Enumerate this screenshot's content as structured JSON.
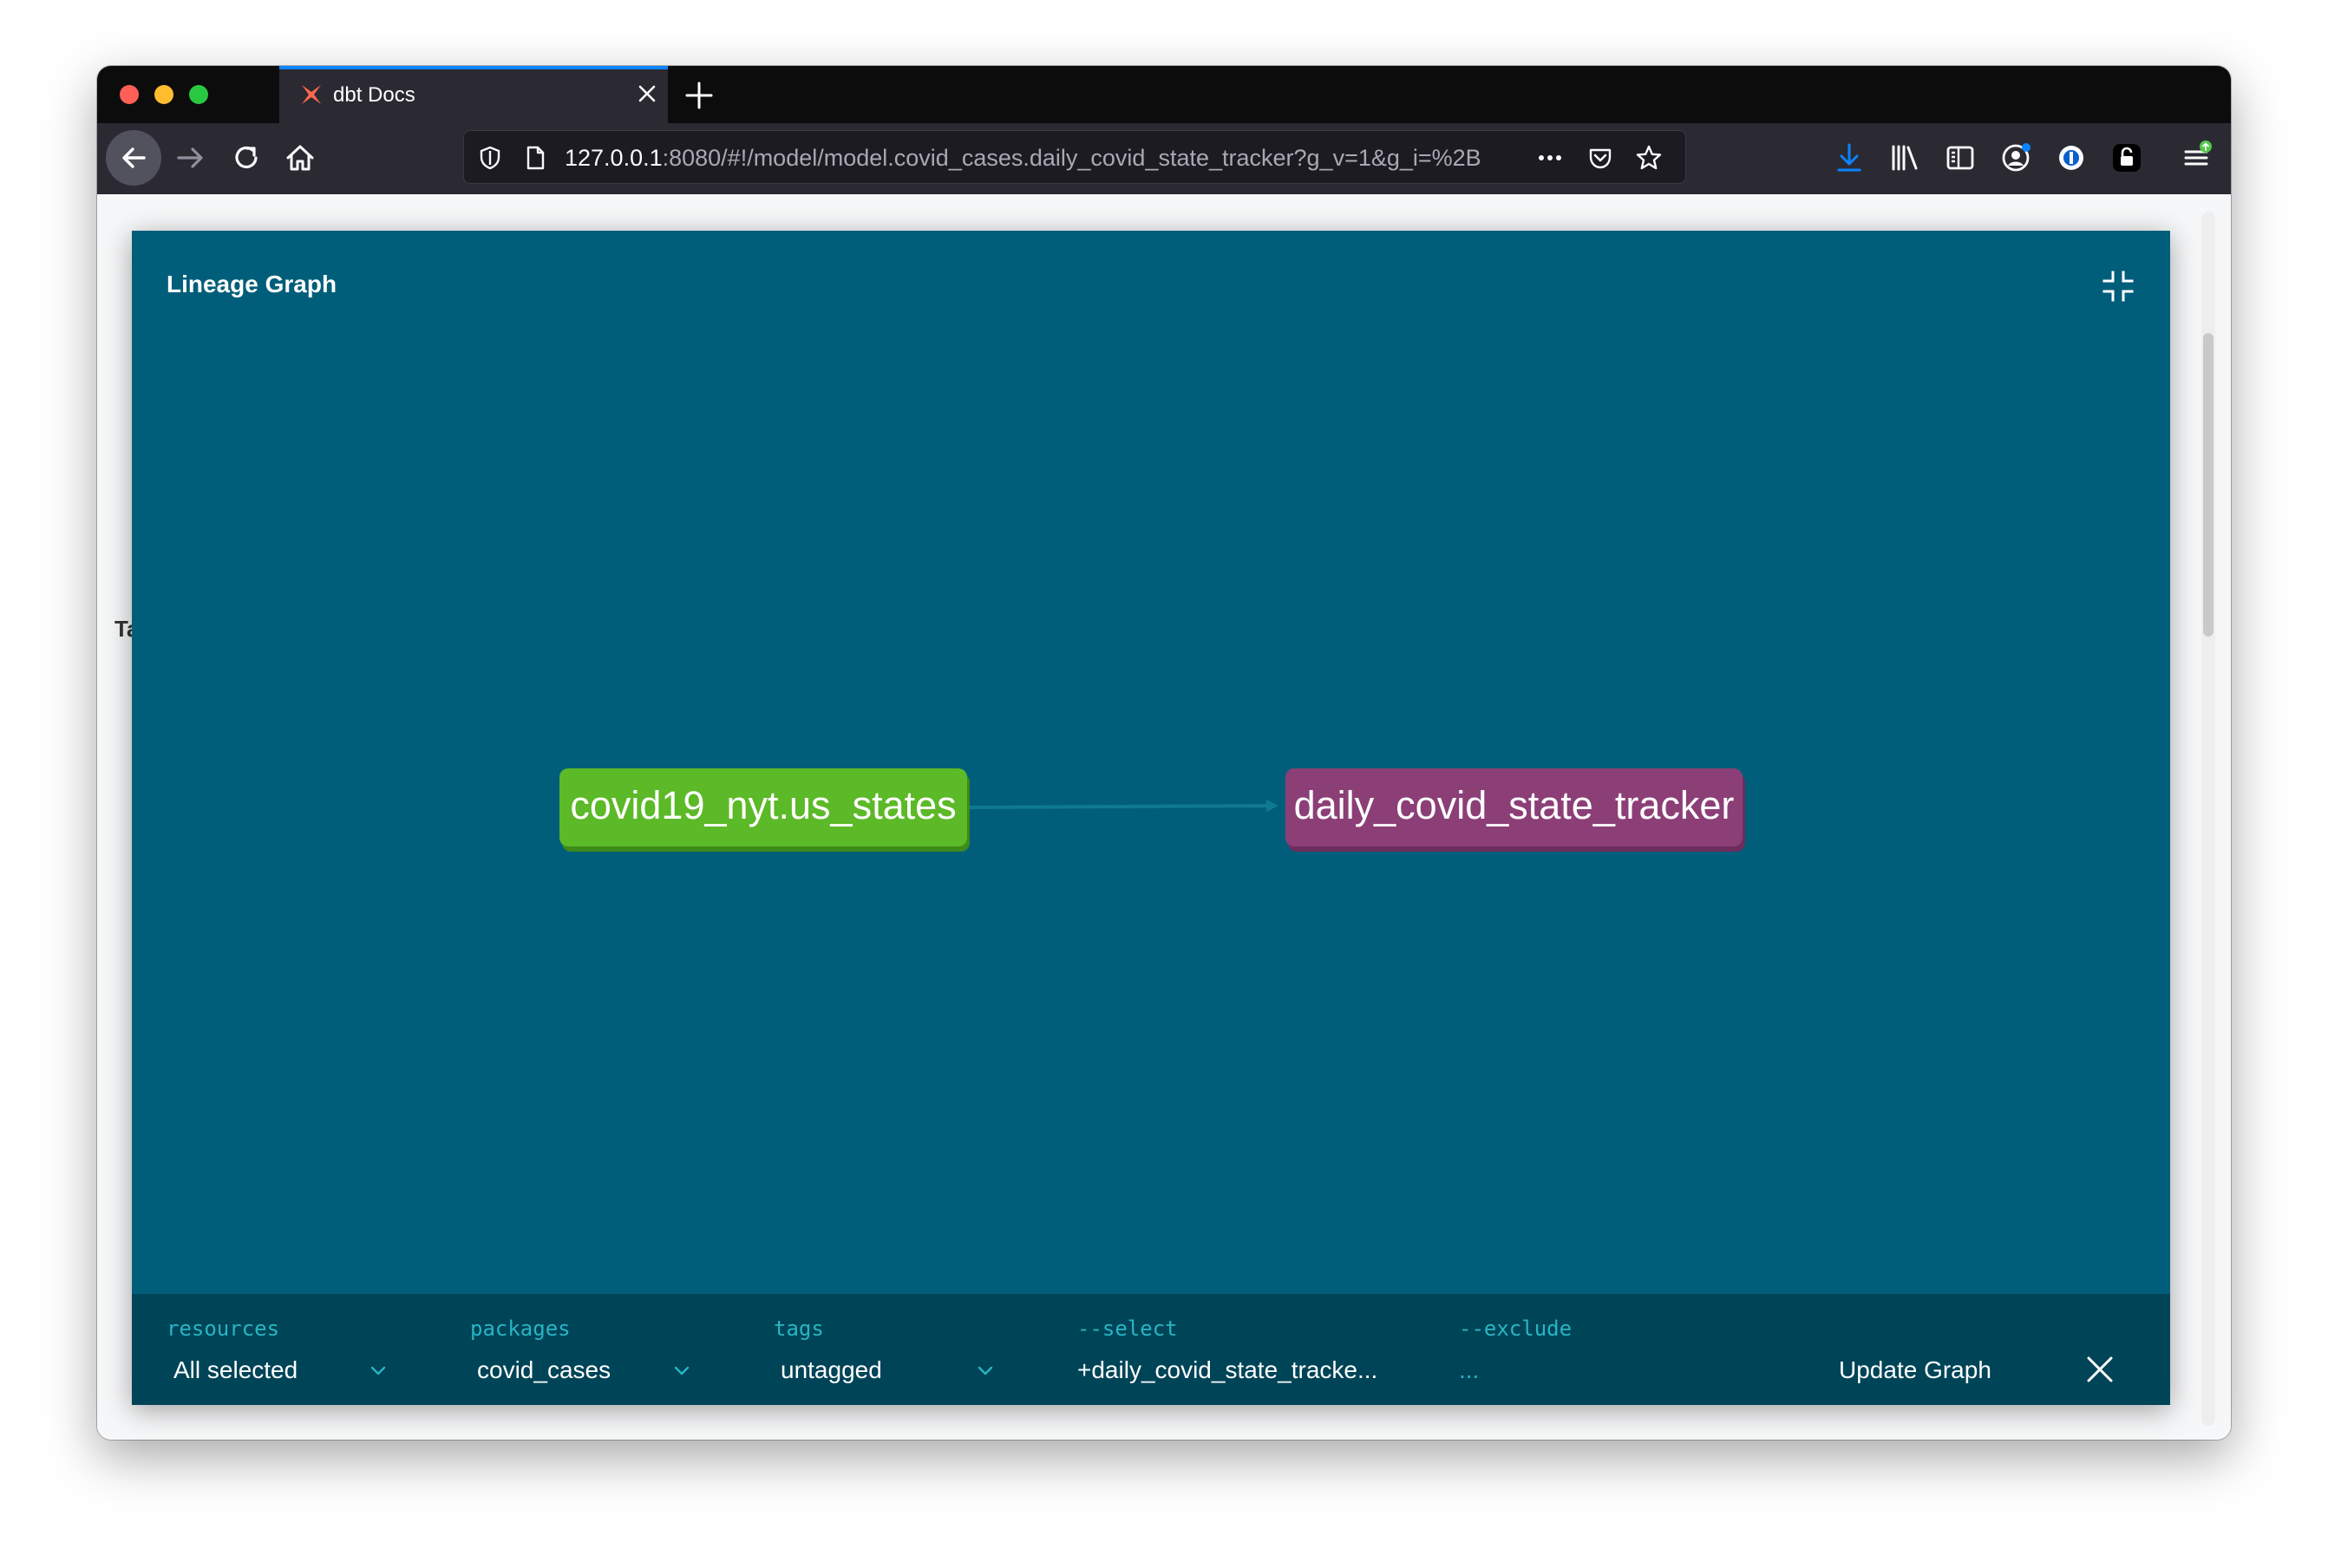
{
  "browser": {
    "tab_title": "dbt Docs",
    "url_host": "127.0.0.1",
    "url_path": ":8080/#!/model/model.covid_cases.daily_covid_state_tracker?g_v=1&g_i=%2B"
  },
  "page": {
    "behind_text": "Ta"
  },
  "graph": {
    "title": "Lineage Graph",
    "nodes": [
      {
        "label": "covid19_nyt.us_states",
        "color": "#5cb927",
        "kind": "source"
      },
      {
        "label": "daily_covid_state_tracker",
        "color": "#8c3f77",
        "kind": "model"
      }
    ],
    "controls": {
      "resources": {
        "label": "resources",
        "value": "All selected"
      },
      "packages": {
        "label": "packages",
        "value": "covid_cases"
      },
      "tags": {
        "label": "tags",
        "value": "untagged"
      },
      "select": {
        "label": "--select",
        "value": "+daily_covid_state_tracke..."
      },
      "exclude": {
        "label": "--exclude",
        "value": "..."
      },
      "update_label": "Update Graph"
    }
  },
  "colors": {
    "graph_background": "#005e7a",
    "controls_background": "#004457",
    "control_label": "#28b5c4"
  }
}
